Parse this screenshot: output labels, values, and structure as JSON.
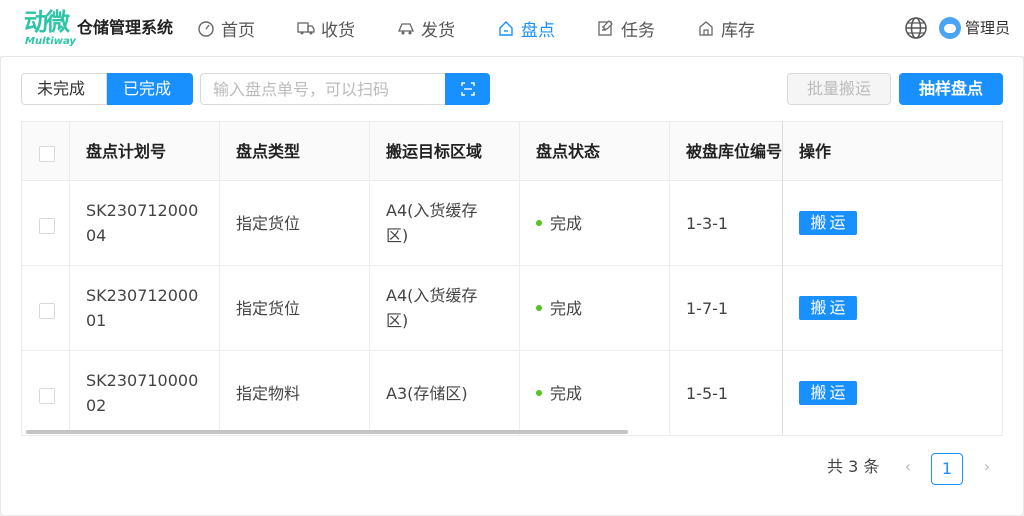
{
  "brand": {
    "logo_cn": "动微",
    "logo_en": "Multiway",
    "app_title": "仓储管理系统"
  },
  "nav": [
    {
      "label": "首页",
      "icon": "dashboard-icon"
    },
    {
      "label": "收货",
      "icon": "truck-icon"
    },
    {
      "label": "发货",
      "icon": "delivery-icon"
    },
    {
      "label": "盘点",
      "icon": "home-icon"
    },
    {
      "label": "任务",
      "icon": "edit-icon"
    },
    {
      "label": "库存",
      "icon": "warehouse-icon"
    }
  ],
  "active_nav": "盘点",
  "user": {
    "name": "管理员"
  },
  "filter": {
    "tab_incomplete": "未完成",
    "tab_complete": "已完成",
    "active_tab": "已完成"
  },
  "search": {
    "placeholder": "输入盘点单号，可以扫码",
    "value": ""
  },
  "actions": {
    "batch_move": "批量搬运",
    "sample_count": "抽样盘点"
  },
  "table": {
    "columns": [
      "盘点计划号",
      "盘点类型",
      "搬运目标区域",
      "盘点状态",
      "被盘库位编号",
      "操作"
    ],
    "rows": [
      {
        "plan_no_1": "SK230712000",
        "plan_no_2": "04",
        "type": "指定货位",
        "area_1": "A4(入货缓存",
        "area_2": "区)",
        "status": "完成",
        "location": "1-3-1",
        "action": "搬运"
      },
      {
        "plan_no_1": "SK230712000",
        "plan_no_2": "01",
        "type": "指定货位",
        "area_1": "A4(入货缓存",
        "area_2": "区)",
        "status": "完成",
        "location": "1-7-1",
        "action": "搬运"
      },
      {
        "plan_no_1": "SK230710000",
        "plan_no_2": "02",
        "type": "指定物料",
        "area_1": "A3(存储区)",
        "area_2": "",
        "status": "完成",
        "location": "1-5-1",
        "action": "搬运"
      }
    ]
  },
  "pagination": {
    "total": "共 3 条",
    "current_page": "1",
    "prev": "‹",
    "next": "›"
  },
  "colors": {
    "primary": "#1890ff",
    "brand": "#2ec4a8",
    "success": "#52c41a"
  }
}
